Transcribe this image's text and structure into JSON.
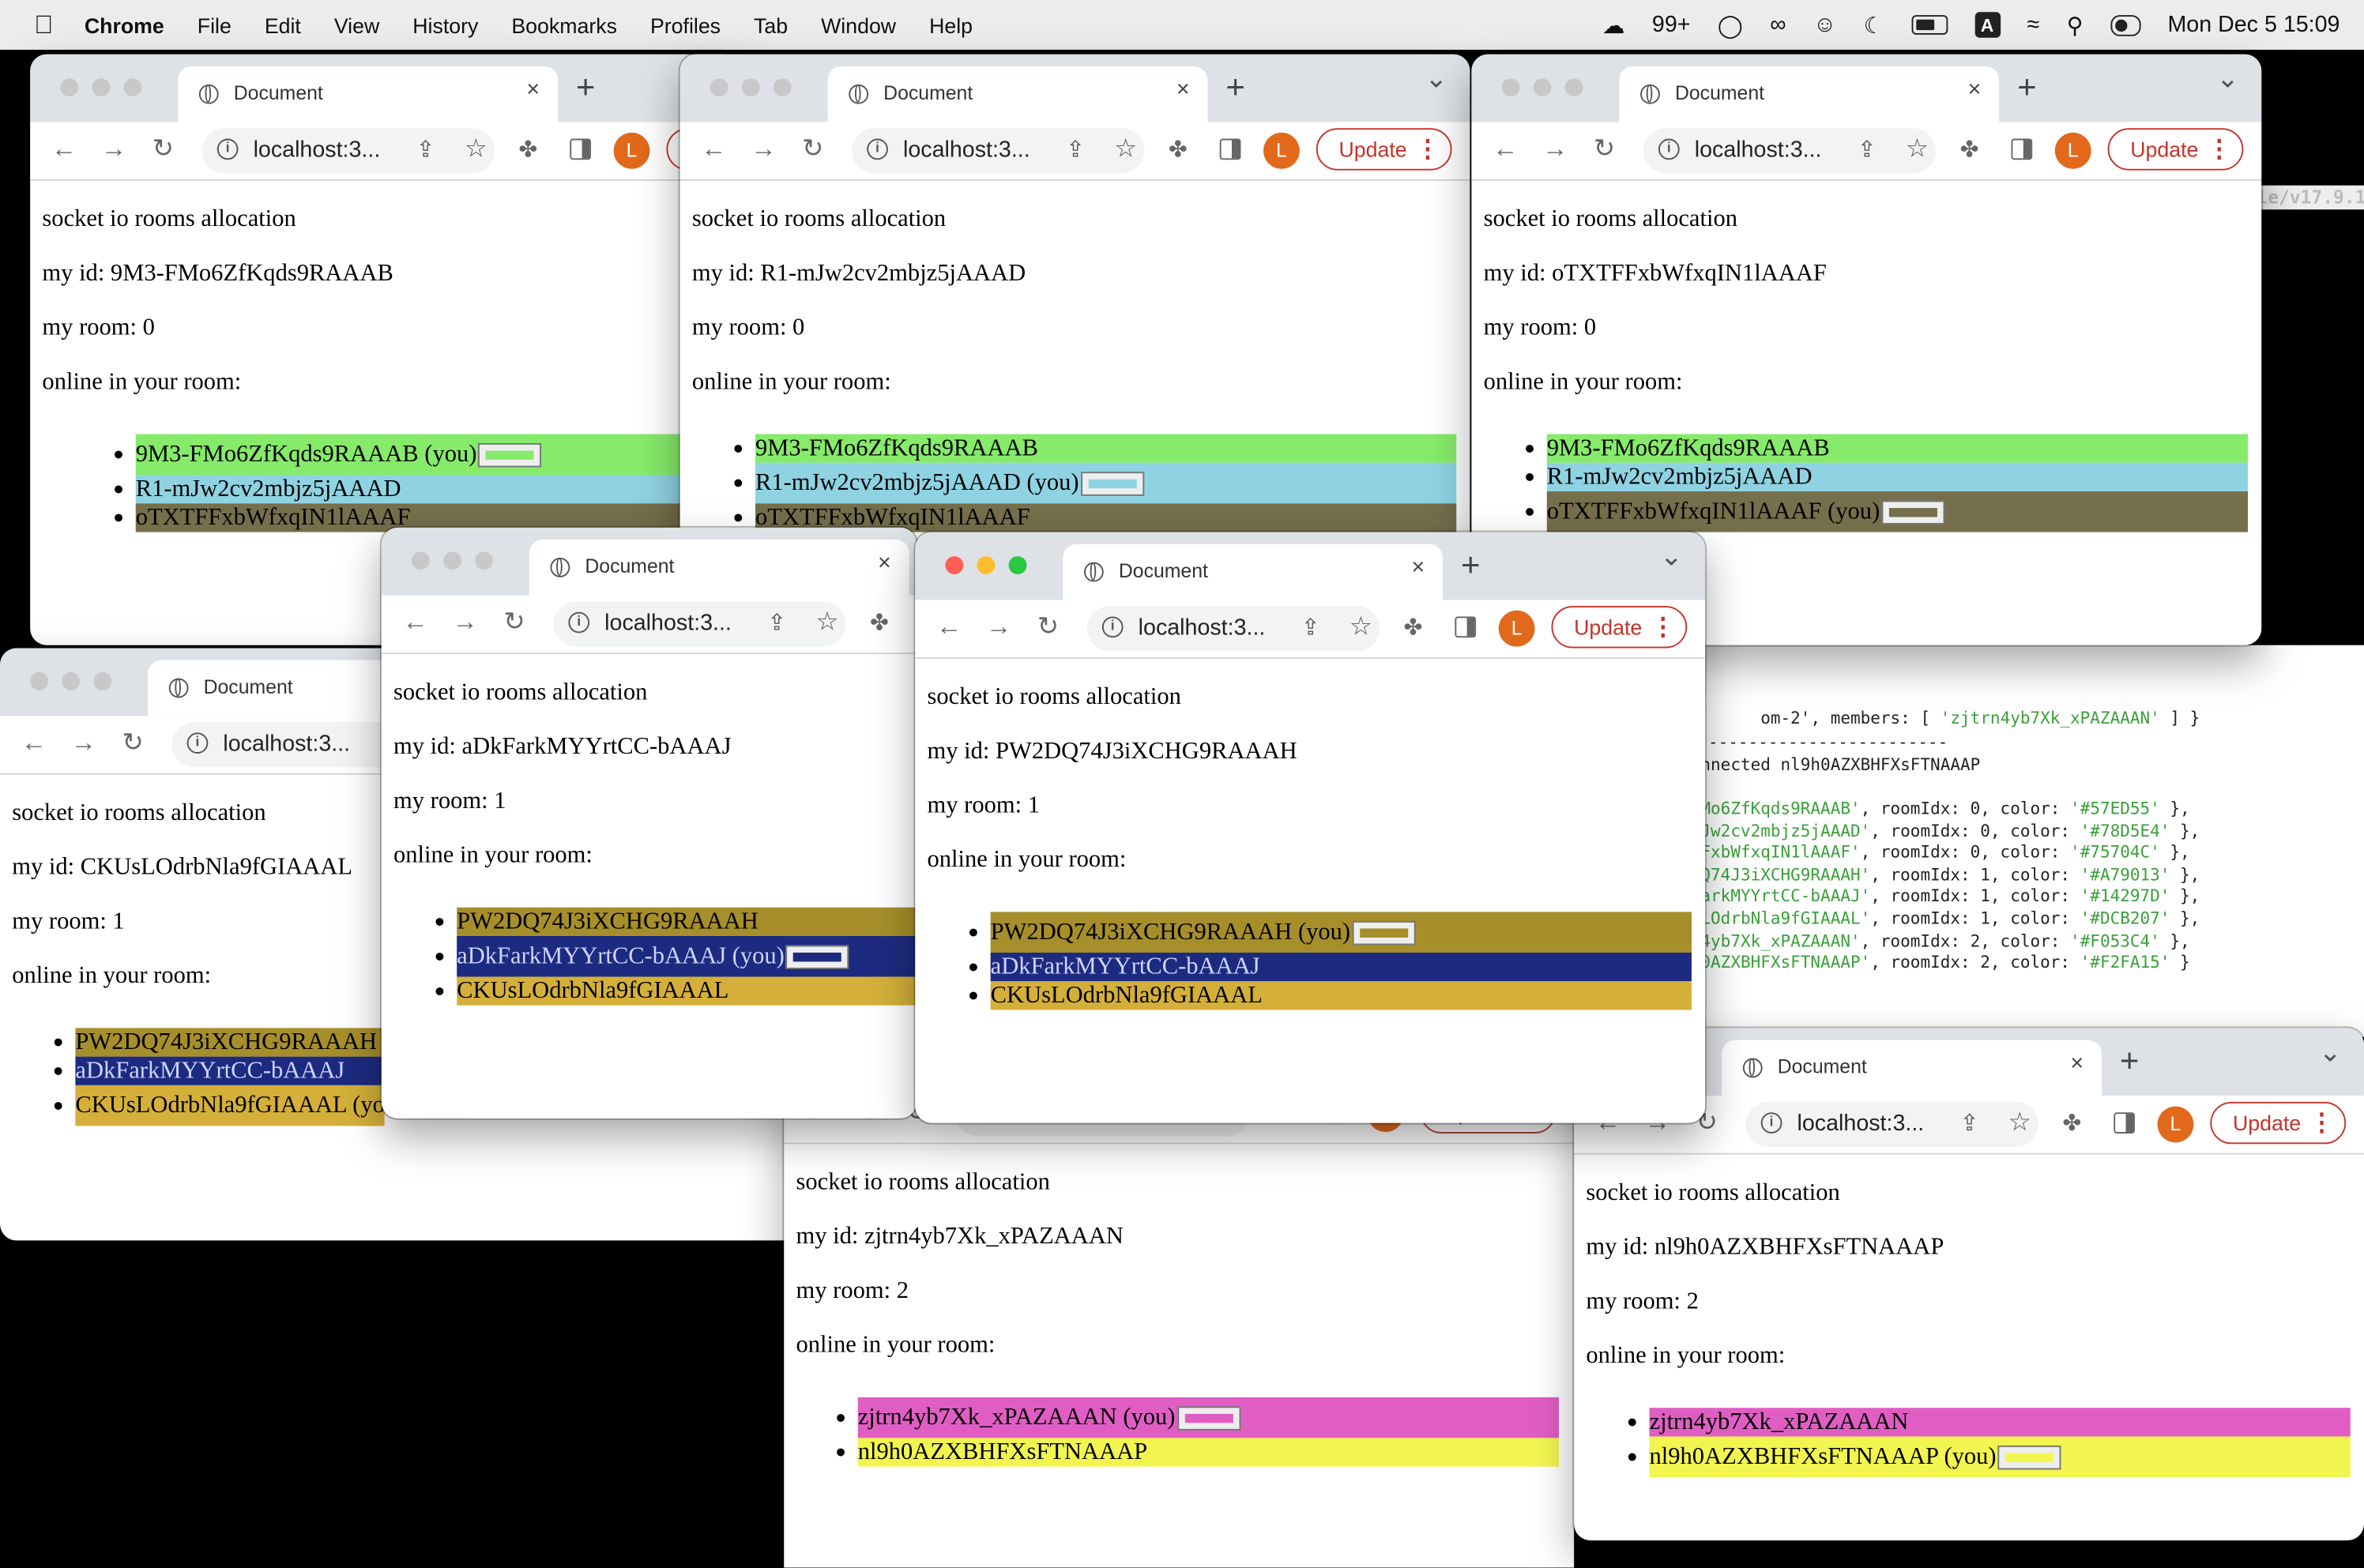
{
  "menubar": {
    "app": "Chrome",
    "items": [
      "File",
      "Edit",
      "View",
      "History",
      "Bookmarks",
      "Profiles",
      "Tab",
      "Window",
      "Help"
    ],
    "notif_count": "99+",
    "datetime": "Mon Dec 5  15:09",
    "input_badge": "A",
    "icons": [
      "apple-icon",
      "wechat-icon",
      "onepassword-icon",
      "creative-cloud-icon",
      "finder-icon",
      "moon-icon",
      "battery-icon",
      "wifi-icon",
      "search-icon",
      "control-center-icon"
    ]
  },
  "terminal": {
    "path_hint": "le/v17.9.1/l",
    "line1_a": "om-2', members: [ ",
    "line1_b": "'zjtrn4yb7Xk_xPAZAAAN'",
    "line1_c": " ] }",
    "divider": "------------------------",
    "connected": "nnected nl9h0AZXBHFXsFTNAAAP",
    "rows": [
      {
        "id": "Mo6ZfKqds9RAAAB'",
        "idx": "0",
        "color": "'#57ED55'"
      },
      {
        "id": "Jw2cv2mbjz5jAAAD'",
        "idx": "0",
        "color": "'#78D5E4'"
      },
      {
        "id": "FxbWfxqIN1lAAAF'",
        "idx": "0",
        "color": "'#75704C'"
      },
      {
        "id": "Q74J3iXCHG9RAAAH'",
        "idx": "1",
        "color": "'#A79013'"
      },
      {
        "id": "arkMYYrtCC-bAAAJ'",
        "idx": "1",
        "color": "'#14297D'"
      },
      {
        "id": "LOdrbNla9fGIAAAL'",
        "idx": "1",
        "color": "'#DCB207'"
      },
      {
        "id": "4yb7Xk_xPAZAAAN'",
        "idx": "2",
        "color": "'#F053C4'"
      },
      {
        "id": "0AZXBHFXsFTNAAAP'",
        "idx": "2",
        "color": "'#F2FA15'"
      }
    ],
    "room_label": ", roomIdx: ",
    "color_label": ", color: ",
    "tail": " },",
    "tail_last": " }"
  },
  "common": {
    "tab_title": "Document",
    "url": "localhost:3...",
    "update": "Update",
    "avatar": "L",
    "heading": "socket io rooms allocation",
    "you_suffix": " (you)"
  },
  "windows": [
    {
      "my_id": "my id: 9M3-FMo6ZfKqds9RAAAB",
      "my_room": "my room: 0",
      "online": "online in your room:",
      "members": [
        {
          "name": "9M3-FMo6ZfKqds9RAAAB",
          "color": "#86ea6a",
          "you": true
        },
        {
          "name": "R1-mJw2cv2mbjz5jAAAD",
          "color": "#8fd3e2",
          "you": false
        },
        {
          "name": "oTXTFFxbWfxqIN1lAAAF",
          "color": "#766f4c",
          "you": false
        }
      ]
    },
    {
      "my_id": "my id: R1-mJw2cv2mbjz5jAAAD",
      "my_room": "my room: 0",
      "online": "online in your room:",
      "members": [
        {
          "name": "9M3-FMo6ZfKqds9RAAAB",
          "color": "#86ea6a",
          "you": false
        },
        {
          "name": "R1-mJw2cv2mbjz5jAAAD",
          "color": "#8fd3e2",
          "you": true
        },
        {
          "name": "oTXTFFxbWfxqIN1lAAAF",
          "color": "#766f4c",
          "you": false
        }
      ]
    },
    {
      "my_id": "my id: oTXTFFxbWfxqIN1lAAAF",
      "my_room": "my room: 0",
      "online": "online in your room:",
      "members": [
        {
          "name": "9M3-FMo6ZfKqds9RAAAB",
          "color": "#86ea6a",
          "you": false
        },
        {
          "name": "R1-mJw2cv2mbjz5jAAAD",
          "color": "#8fd3e2",
          "you": false
        },
        {
          "name": "oTXTFFxbWfxqIN1lAAAF",
          "color": "#766f4c",
          "you": true
        }
      ]
    },
    {
      "my_id": "my id: CKUsLOdrbNla9fGIAAAL",
      "my_room": "my room: 1",
      "online": "online in your room:",
      "members": [
        {
          "name": "PW2DQ74J3iXCHG9RAAAH",
          "color": "#a68f2a",
          "you": false
        },
        {
          "name": "aDkFarkMYYrtCC-bAAAJ",
          "color": "#1c2b80",
          "you": false
        },
        {
          "name": "CKUsLOdrbNla9fGIAAAL",
          "color": "#d4b03a",
          "you": true
        }
      ]
    },
    {
      "my_id": "my id: aDkFarkMYYrtCC-bAAAJ",
      "my_room": "my room: 1",
      "online": "online in your room:",
      "members": [
        {
          "name": "PW2DQ74J3iXCHG9RAAAH",
          "color": "#a68f2a",
          "you": false
        },
        {
          "name": "aDkFarkMYYrtCC-bAAAJ",
          "color": "#1c2b80",
          "you": true
        },
        {
          "name": "CKUsLOdrbNla9fGIAAAL",
          "color": "#d4b03a",
          "you": false
        }
      ]
    },
    {
      "my_id": "my id: PW2DQ74J3iXCHG9RAAAH",
      "my_room": "my room: 1",
      "online": "online in your room:",
      "members": [
        {
          "name": "PW2DQ74J3iXCHG9RAAAH",
          "color": "#a68f2a",
          "you": true
        },
        {
          "name": "aDkFarkMYYrtCC-bAAAJ",
          "color": "#1c2b80",
          "you": false
        },
        {
          "name": "CKUsLOdrbNla9fGIAAAL",
          "color": "#d4b03a",
          "you": false
        }
      ]
    },
    {
      "my_id": "my id: zjtrn4yb7Xk_xPAZAAAN",
      "my_room": "my room: 2",
      "online": "online in your room:",
      "members": [
        {
          "name": "zjtrn4yb7Xk_xPAZAAAN",
          "color": "#e05ec4",
          "you": true
        },
        {
          "name": "nl9h0AZXBHFXsFTNAAAP",
          "color": "#f2f54f",
          "you": false
        }
      ]
    },
    {
      "my_id": "my id: nl9h0AZXBHFXsFTNAAAP",
      "my_room": "my room: 2",
      "online": "online in your room:",
      "members": [
        {
          "name": "zjtrn4yb7Xk_xPAZAAAN",
          "color": "#e05ec4",
          "you": false
        },
        {
          "name": "nl9h0AZXBHFXsFTNAAAP",
          "color": "#f2f54f",
          "you": true
        }
      ]
    }
  ]
}
